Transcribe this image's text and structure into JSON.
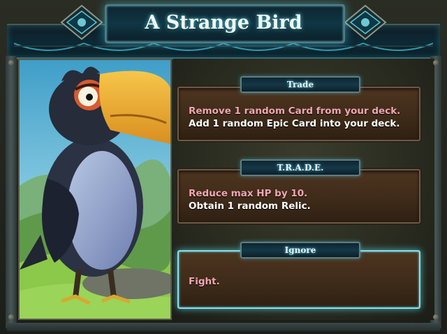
{
  "event": {
    "title": "A Strange Bird"
  },
  "options": [
    {
      "tab_label": "Trade",
      "line1": "Remove 1 random Card from your deck.",
      "line2": "Add 1 random Epic Card into your deck.",
      "selected": false
    },
    {
      "tab_label": "T.R.A.D.E.",
      "line1": "Reduce max HP by 10.",
      "line2": "Obtain 1 random Relic.",
      "selected": false
    },
    {
      "tab_label": "Ignore",
      "line1": "Fight.",
      "line2": "",
      "selected": true
    }
  ],
  "colors": {
    "negative_text": "#f3a6b2",
    "positive_text": "#ffffff",
    "highlight_glow": "#7fe3ee"
  }
}
